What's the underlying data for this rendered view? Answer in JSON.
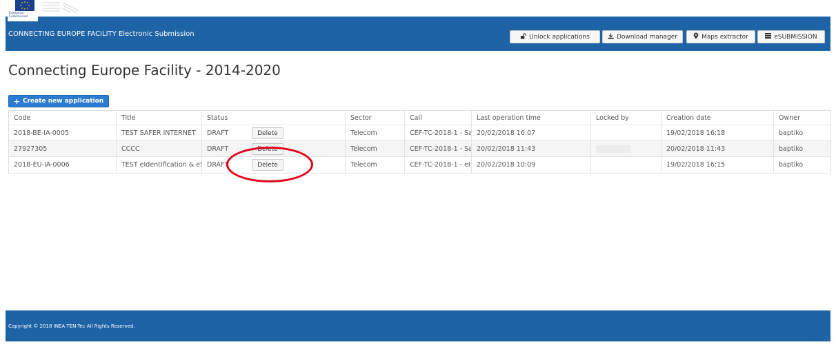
{
  "logo": {
    "text": "European\nCommission",
    "name": "european-commission-logo"
  },
  "header": {
    "title": "CONNECTING EUROPE FACILITY Electronic Submission",
    "buttons": [
      {
        "label": "Unlock applications",
        "icon": "unlock-icon"
      },
      {
        "label": "Download manager",
        "icon": "download-icon"
      },
      {
        "label": "Maps extractor",
        "icon": "map-marker-icon"
      },
      {
        "label": "eSUBMISSION",
        "icon": "list-icon"
      }
    ]
  },
  "page_title": "Connecting Europe Facility - 2014-2020",
  "create_button": {
    "icon": "plus-icon",
    "label": "Create new application"
  },
  "table": {
    "headers": [
      "Code",
      "Title",
      "Status",
      "Sector",
      "Call",
      "Last operation time",
      "Locked by",
      "Creation date",
      "Owner"
    ],
    "delete_label": "Delete",
    "rows": [
      {
        "code": "2018-BE-IA-0005",
        "title": "TEST SAFER INTERNET",
        "status": "DRAFT",
        "sector": "Telecom",
        "call": "CEF-TC-2018-1 - Sa",
        "last_op": "20/02/2018 16:07",
        "locked_by": "",
        "created": "19/02/2018 16:18",
        "owner": "baptiko"
      },
      {
        "code": "27927305",
        "title": "CCCC",
        "status": "DRAFT",
        "sector": "Telecom",
        "call": "CEF-TC-2018-1 - Sa",
        "last_op": "20/02/2018 11:43",
        "locked_by": "",
        "created": "20/02/2018 11:43",
        "owner": "baptiko"
      },
      {
        "code": "2018-EU-IA-0006",
        "title": "TEST eIdentification & eSig",
        "status": "DRAFT",
        "sector": "Telecom",
        "call": "CEF-TC-2018-1 - eI",
        "last_op": "20/02/2018 10:09",
        "locked_by": "",
        "created": "19/02/2018 16:15",
        "owner": "baptiko"
      }
    ]
  },
  "footer": {
    "text": "Copyright © 2018 INEA TEN-Tec All Rights Reserved."
  },
  "colors": {
    "brand_blue": "#1d63a6",
    "button_blue": "#2b7bd3",
    "annotation_red": "#e3001a"
  }
}
